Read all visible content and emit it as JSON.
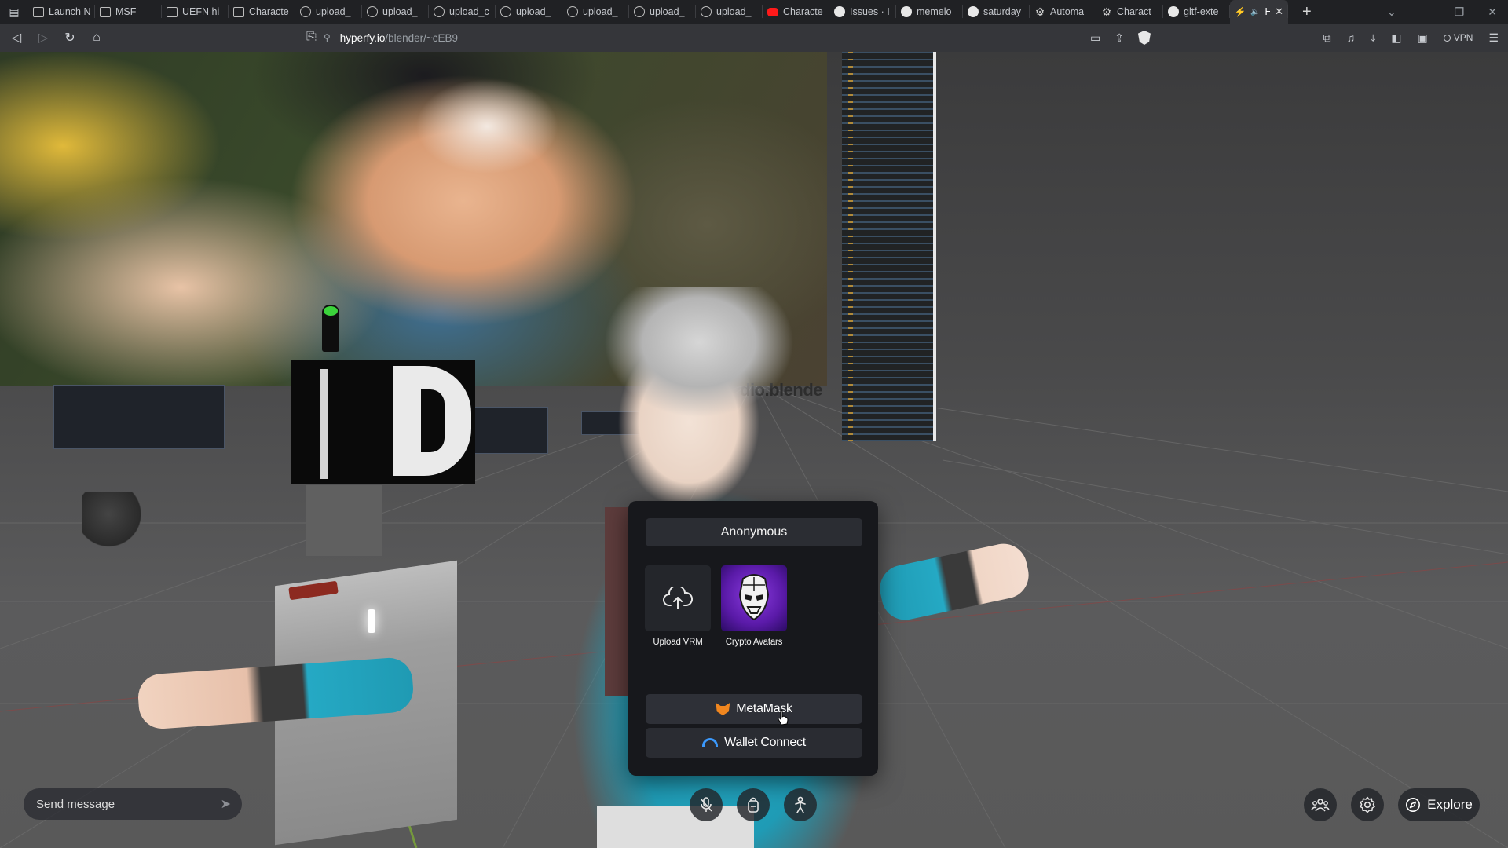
{
  "browser": {
    "tabs": [
      {
        "title": "Launch N",
        "icon": "doc"
      },
      {
        "title": "MSF",
        "icon": "doc"
      },
      {
        "title": "UEFN hi",
        "icon": "doc"
      },
      {
        "title": "Characte",
        "icon": "doc"
      },
      {
        "title": "upload_",
        "icon": "globe"
      },
      {
        "title": "upload_",
        "icon": "globe"
      },
      {
        "title": "upload_c",
        "icon": "globe"
      },
      {
        "title": "upload_",
        "icon": "globe"
      },
      {
        "title": "upload_",
        "icon": "globe"
      },
      {
        "title": "upload_",
        "icon": "globe"
      },
      {
        "title": "upload_",
        "icon": "globe"
      },
      {
        "title": "Characte",
        "icon": "youtube"
      },
      {
        "title": "Issues · I",
        "icon": "github"
      },
      {
        "title": "memelo",
        "icon": "github"
      },
      {
        "title": "saturday",
        "icon": "github"
      },
      {
        "title": "Automa",
        "icon": "gear"
      },
      {
        "title": "Charact",
        "icon": "gear"
      },
      {
        "title": "gltf-exte",
        "icon": "github"
      },
      {
        "title": "H",
        "icon": "bolt",
        "active": true
      }
    ],
    "address": {
      "host": "hyperfy.io",
      "path": "/blender/~cEB9"
    },
    "vpn_label": "VPN"
  },
  "scene": {
    "poster_text": "dio.blende"
  },
  "avatar_modal": {
    "title": "Anonymous",
    "options": [
      {
        "label": "Upload VRM",
        "icon": "cloud-upload-icon"
      },
      {
        "label": "Crypto Avatars",
        "icon": "crypto-avatar-icon"
      }
    ],
    "metamask_label": "MetaMask",
    "walletconnect_label": "Wallet Connect"
  },
  "hud": {
    "chat_placeholder": "Send message",
    "explore_label": "Explore"
  },
  "colors": {
    "modal_bg": "#17181c",
    "button_bg": "#2a2c32",
    "metamask_orange": "#f0861f",
    "walletconnect_blue": "#3b99fc",
    "crypto_purple": "#6a24c0"
  }
}
